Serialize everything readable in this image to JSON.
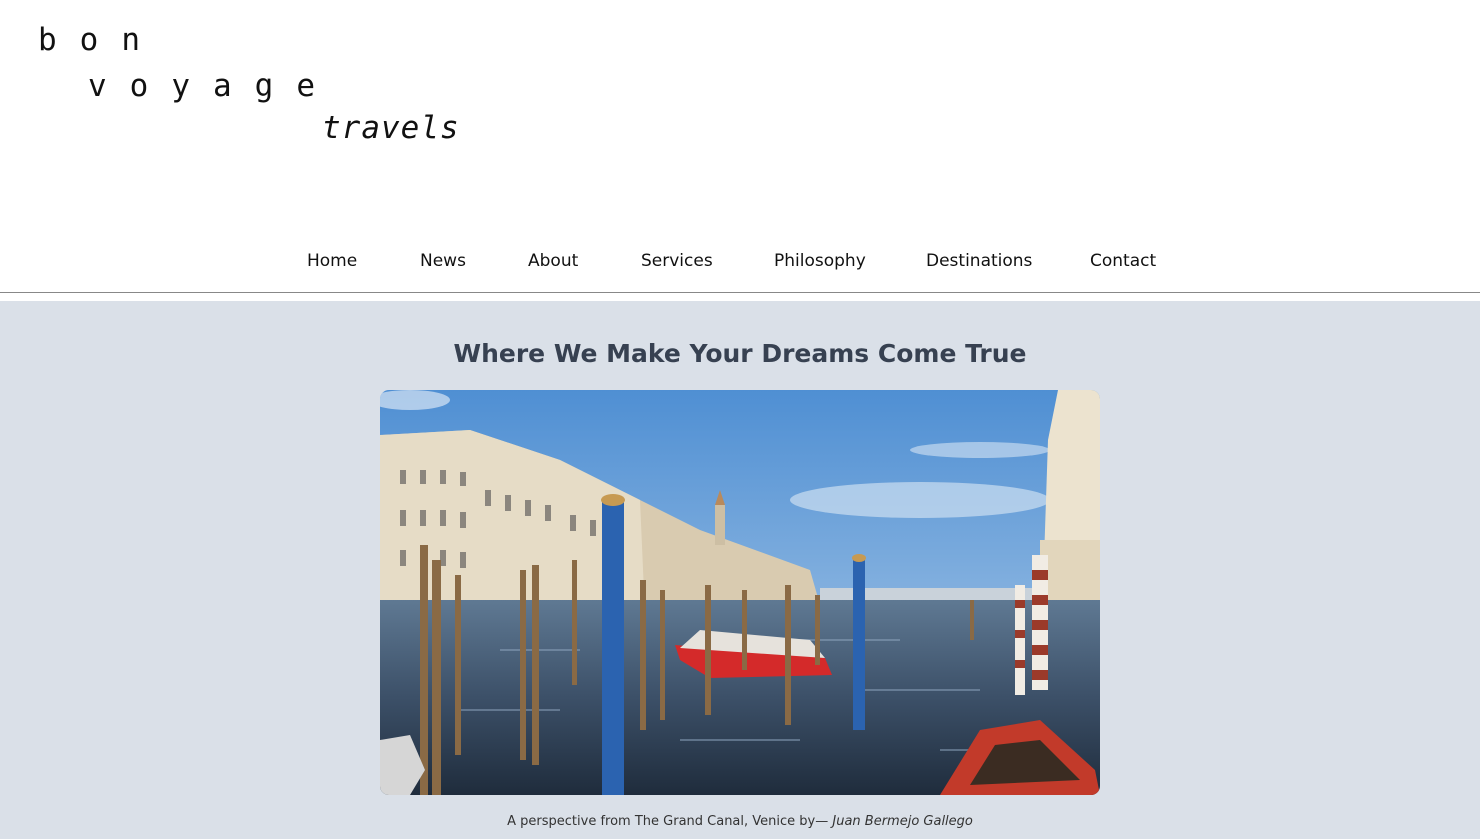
{
  "logo": {
    "line1": "bon",
    "line2": "voyage",
    "line3": "travels"
  },
  "nav": {
    "items": [
      {
        "label": "Home"
      },
      {
        "label": "News"
      },
      {
        "label": "About"
      },
      {
        "label": "Services"
      },
      {
        "label": "Philosophy"
      },
      {
        "label": "Destinations"
      },
      {
        "label": "Contact"
      }
    ]
  },
  "hero": {
    "title": "Where We Make Your Dreams Come True",
    "image_icon": "grand-canal-venice-photo",
    "caption_text": "A perspective from The Grand Canal, Venice by— ",
    "caption_author": "Juan Bermejo Gallego"
  },
  "colors": {
    "band_background": "#dae0e8",
    "heading": "#374151"
  }
}
